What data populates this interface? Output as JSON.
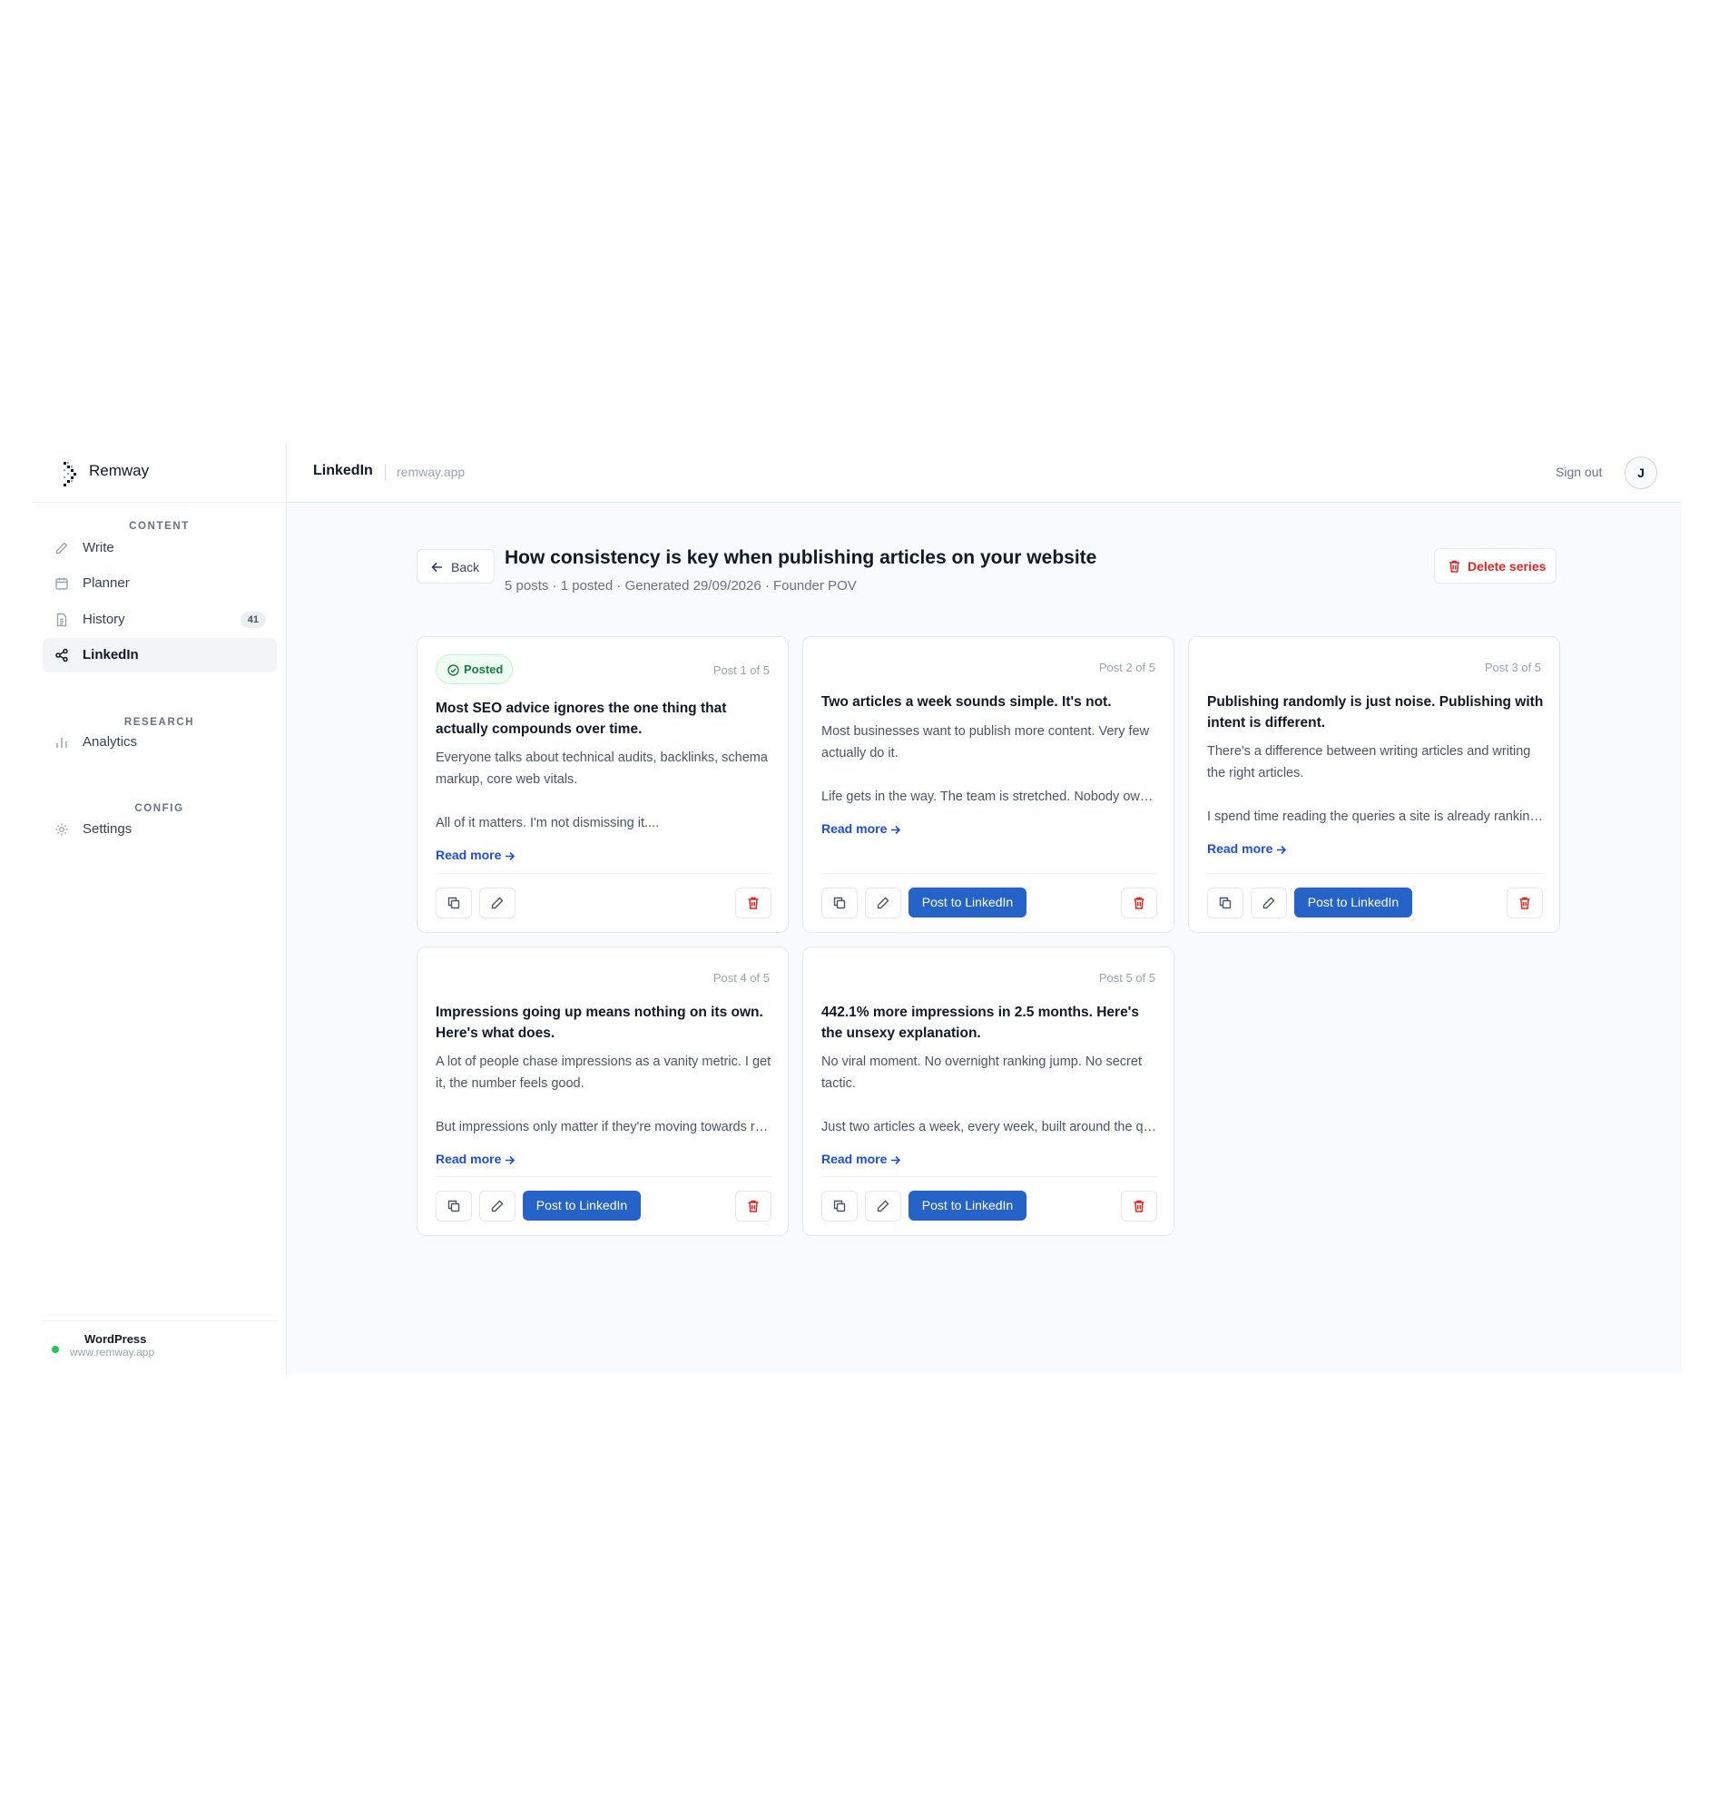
{
  "app": {
    "name": "Remway"
  },
  "sidebar": {
    "sections": {
      "content": "CONTENT",
      "research": "RESEARCH",
      "config": "CONFIG"
    },
    "items": {
      "write": "Write",
      "planner": "Planner",
      "history": "History",
      "history_badge": "41",
      "linkedin": "LinkedIn",
      "analytics": "Analytics",
      "settings": "Settings"
    },
    "site": {
      "name": "WordPress",
      "url": "www.remway.app",
      "status_color": "#22c55e"
    }
  },
  "topbar": {
    "title": "LinkedIn",
    "domain": "remway.app",
    "signout": "Sign out",
    "avatar": "J"
  },
  "series": {
    "back_label": "Back",
    "title": "How consistency is key when publishing articles on your website",
    "meta": "5 posts · 1 posted · Generated 29/09/2026 · Founder POV",
    "delete_label": "Delete series"
  },
  "actions": {
    "post_label": "Post to LinkedIn",
    "read_more": "Read more",
    "posted_label": "Posted"
  },
  "posts": [
    {
      "index": "Post 1 of 5",
      "posted": true,
      "title": "Most SEO advice ignores the one thing that actually compounds over time.",
      "body": "Everyone talks about technical audits, backlinks, schema markup, core web vitals.",
      "excerpt": "All of it matters. I'm not dismissing it...."
    },
    {
      "index": "Post 2 of 5",
      "posted": false,
      "title": "Two articles a week sounds simple. It's not.",
      "body": "Most businesses want to publish more content. Very few actually do it.",
      "excerpt": "Life gets in the way. The team is stretched. Nobody owns it"
    },
    {
      "index": "Post 3 of 5",
      "posted": false,
      "title": "Publishing randomly is just noise. Publishing with intent is different.",
      "body": "There's a difference between writing articles and writing the right articles.",
      "excerpt": "I spend time reading the queries a site is already ranking for"
    },
    {
      "index": "Post 4 of 5",
      "posted": false,
      "title": "Impressions going up means nothing on its own. Here's what does.",
      "body": "A lot of people chase impressions as a vanity metric. I get it, the number feels good.",
      "excerpt": "But impressions only matter if they're moving towards revenue"
    },
    {
      "index": "Post 5 of 5",
      "posted": false,
      "title": "442.1% more impressions in 2.5 months. Here's the unsexy explanation.",
      "body": "No viral moment. No overnight ranking jump. No secret tactic.",
      "excerpt": "Just two articles a week, every week, built around the queries"
    }
  ],
  "colors": {
    "accent": "#2563c8",
    "link": "#1d4ed8",
    "danger": "#dc2626",
    "success": "#15803d"
  },
  "icons": [
    "pencil-icon",
    "calendar-icon",
    "document-icon",
    "share-icon",
    "bar-chart-icon",
    "gear-icon",
    "arrow-left-icon",
    "trash-icon",
    "copy-icon",
    "arrow-right-icon",
    "check-circle-icon"
  ]
}
